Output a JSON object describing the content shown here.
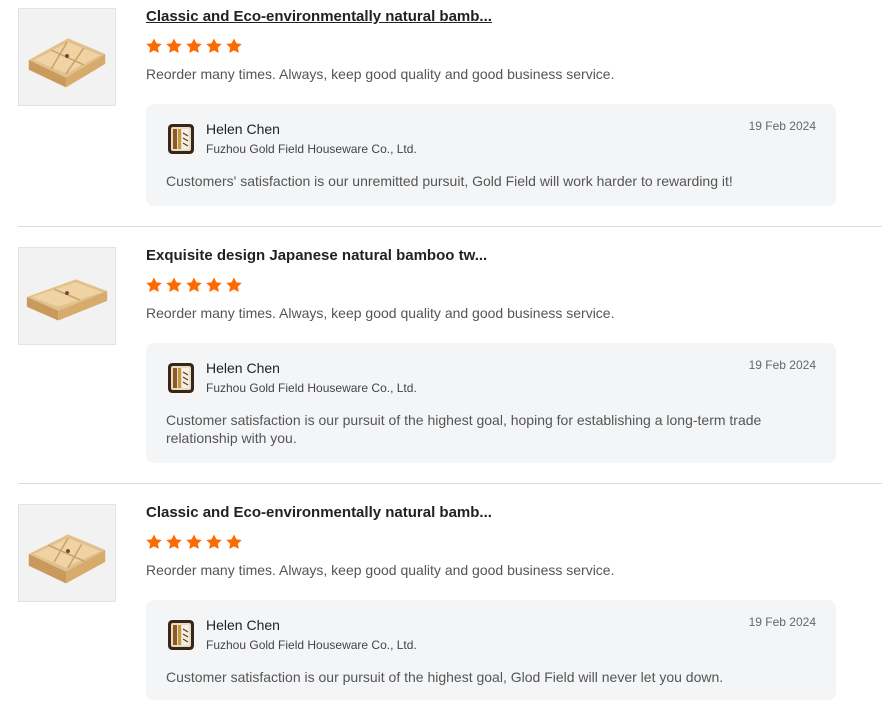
{
  "reviews": [
    {
      "product_title": "Classic and Eco-environmentally natural bamb...",
      "rating": 5,
      "comment": "Reorder many times. Always, keep good quality and good business service.",
      "reply": {
        "name": "Helen Chen",
        "company": "Fuzhou Gold Field Houseware Co., Ltd.",
        "date": "19 Feb 2024",
        "text": "Customers' satisfaction is our unremitted pursuit, Gold Field will work harder to rewarding it!"
      }
    },
    {
      "product_title": "Exquisite design Japanese natural bamboo tw...",
      "rating": 5,
      "comment": "Reorder many times. Always, keep good quality and good business service.",
      "reply": {
        "name": "Helen Chen",
        "company": "Fuzhou Gold Field Houseware Co., Ltd.",
        "date": "19 Feb 2024",
        "text": "Customer satisfaction is our pursuit of the highest goal, hoping for establishing a long-term trade relationship with you."
      }
    },
    {
      "product_title": "Classic and Eco-environmentally natural bamb...",
      "rating": 5,
      "comment": "Reorder many times. Always, keep good quality and good business service.",
      "reply": {
        "name": "Helen Chen",
        "company": "Fuzhou Gold Field Houseware Co., Ltd.",
        "date": "19 Feb 2024",
        "text": "Customer satisfaction is our pursuit of the highest goal, Glod Field will never let you down."
      }
    }
  ],
  "colors": {
    "star": "#ff6a00",
    "reply_bg": "#f4f5f7",
    "divider": "#dcdcdc"
  },
  "icons": {
    "star": "star-icon",
    "product_thumbnail": "bamboo-tray-image",
    "seller_logo": "company-logo"
  }
}
